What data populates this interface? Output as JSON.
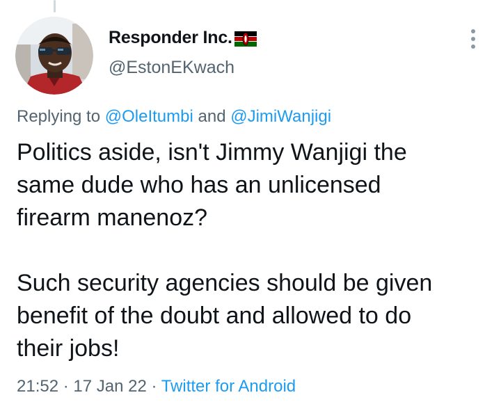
{
  "author": {
    "display_name": "Responder Inc.",
    "handle": "@EstonEKwach",
    "flag": "kenya-flag-icon"
  },
  "reply_context": {
    "prefix": "Replying to ",
    "mention_1": "@OleItumbi",
    "joiner": " and ",
    "mention_2": "@JimiWanjigi"
  },
  "tweet": {
    "lines_para_1": [
      "Politics aside, isn't Jimmy Wanjigi the",
      "same dude who has an unlicensed",
      "firearm manenoz?"
    ],
    "lines_para_2": [
      "Such security agencies should be given",
      "benefit of the doubt and allowed to do",
      "their jobs!"
    ]
  },
  "meta": {
    "time": "21:52",
    "separator_1": " · ",
    "date": "17 Jan 22",
    "separator_2": " · ",
    "source": "Twitter for Android"
  },
  "colors": {
    "text": "#0f1419",
    "secondary": "#536471",
    "link": "#1d9bf0"
  }
}
